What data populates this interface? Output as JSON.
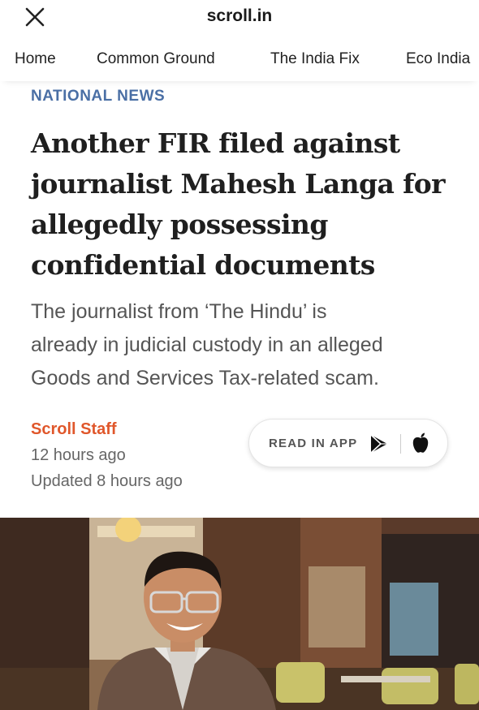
{
  "header": {
    "site_title": "scroll.in",
    "close_icon": "close-icon"
  },
  "nav": {
    "items": [
      {
        "label": "Home"
      },
      {
        "label": "Common Ground"
      },
      {
        "label": "The India Fix"
      },
      {
        "label": "Eco India"
      }
    ]
  },
  "article": {
    "section": "NATIONAL NEWS",
    "headline_lines": [
      "Another FIR filed against",
      "journalist Mahesh Langa for",
      "allegedly possessing",
      "confidential documents"
    ],
    "subhead_lines": [
      "The journalist from ‘The Hindu’ is",
      "already in judicial custody in an alleged",
      "Goods and Services Tax-related scam."
    ],
    "author": "Scroll Staff",
    "published": "12 hours ago",
    "updated": "Updated 8 hours ago"
  },
  "app_button": {
    "label": "READ IN APP",
    "icons": [
      "google-play-icon",
      "apple-icon"
    ]
  },
  "colors": {
    "section": "#4a6fa5",
    "author": "#e0572b",
    "headline": "#1f1f1f"
  }
}
